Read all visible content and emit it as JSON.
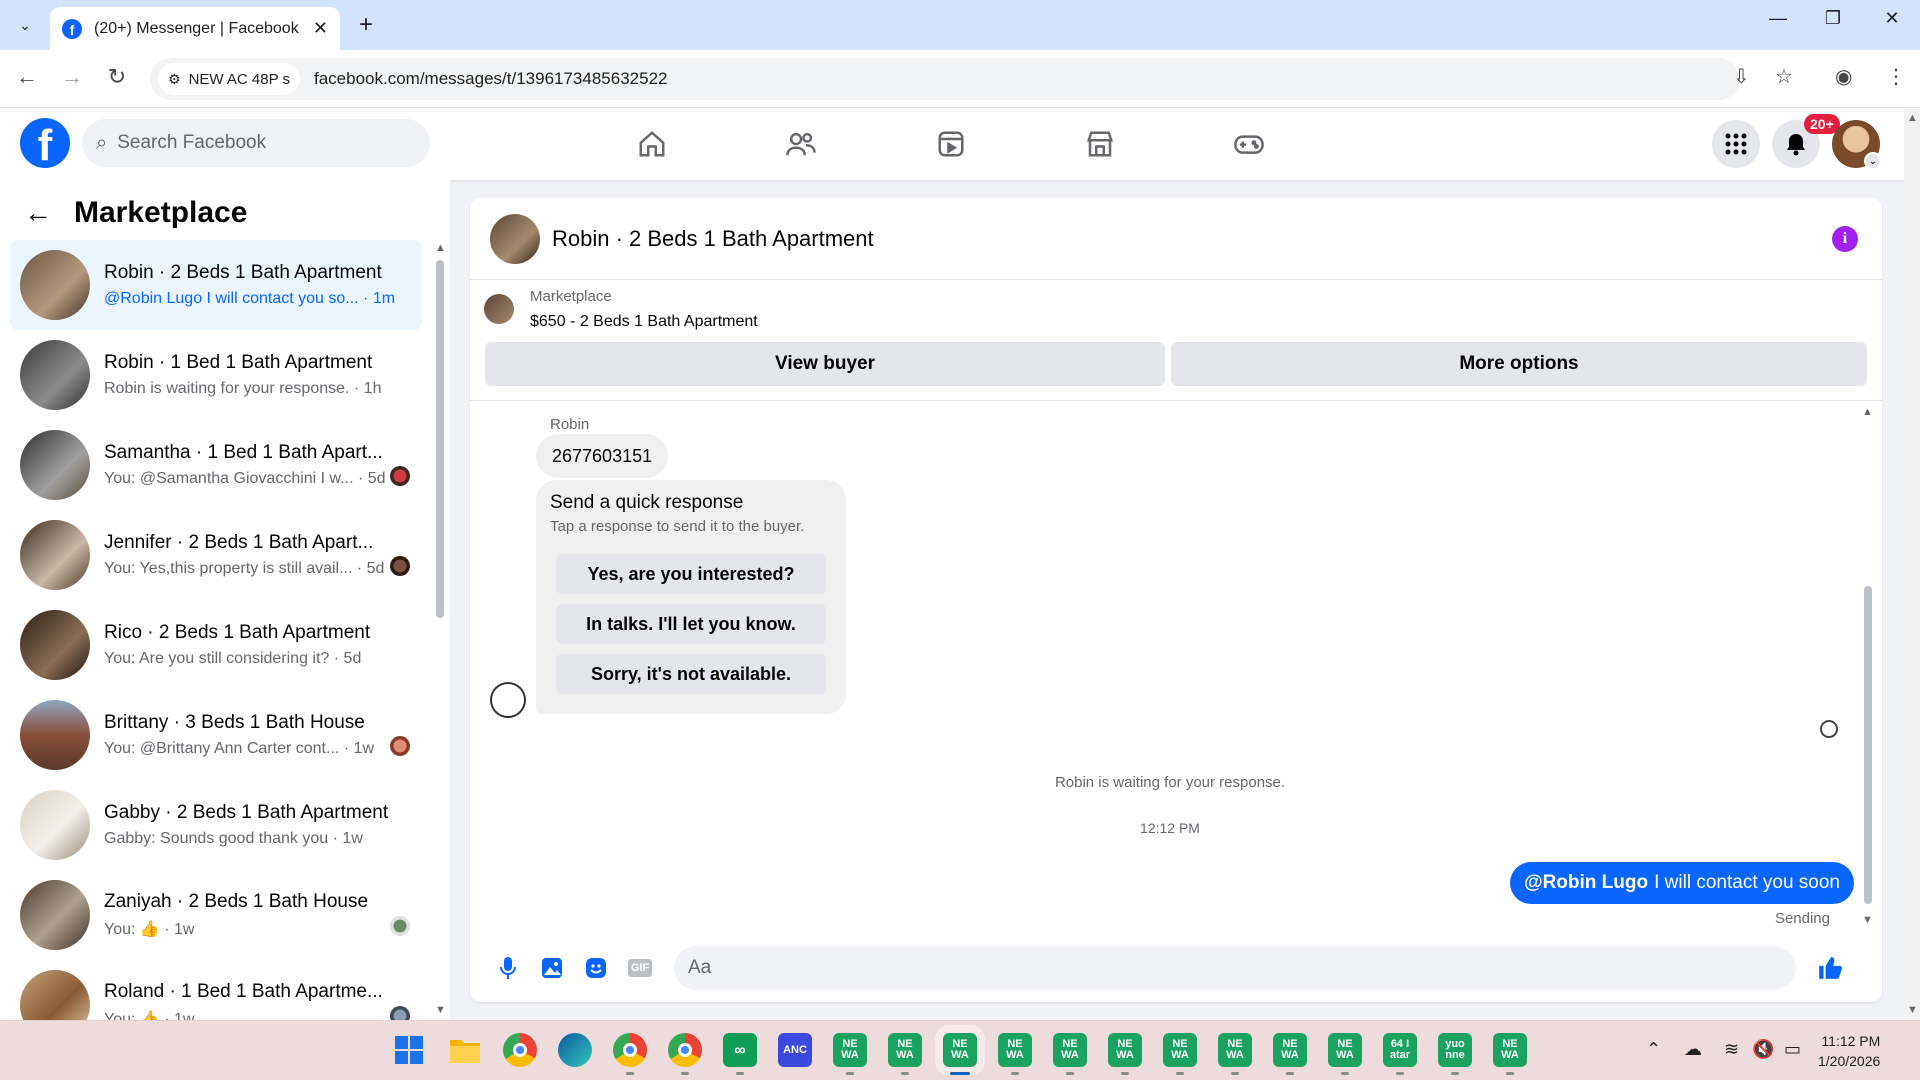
{
  "browser": {
    "tab_title": "(20+) Messenger | Facebook",
    "site_chip": "NEW AC 48P s",
    "url": "facebook.com/messages/t/1396173485632522"
  },
  "fb": {
    "search_placeholder": "Search Facebook",
    "notification_badge": "20+"
  },
  "sidebar": {
    "title": "Marketplace",
    "conversations": [
      {
        "name": "Robin · 2 Beds 1 Bath Apartment",
        "preview": "@Robin Lugo I will contact you so... · 1m",
        "active": true
      },
      {
        "name": "Robin · 1 Bed 1 Bath Apartment",
        "preview": "Robin is waiting for your response. · 1h"
      },
      {
        "name": "Samantha · 1 Bed 1 Bath Apart...",
        "preview": "You: @Samantha Giovacchini I w... · 5d"
      },
      {
        "name": "Jennifer · 2 Beds 1 Bath Apart...",
        "preview": "You: Yes,this property is still avail... · 5d"
      },
      {
        "name": "Rico · 2 Beds 1 Bath Apartment",
        "preview": "You: Are you still considering it? · 5d"
      },
      {
        "name": "Brittany · 3 Beds 1 Bath House",
        "preview": "You: @Brittany Ann Carter cont... · 1w"
      },
      {
        "name": "Gabby · 2 Beds 1 Bath Apartment",
        "preview": "Gabby: Sounds good thank you · 1w"
      },
      {
        "name": "Zaniyah · 2 Beds 1 Bath House",
        "preview": "You: 👍 · 1w"
      },
      {
        "name": "Roland · 1 Bed 1 Bath Apartme...",
        "preview": "You: 👍 · 1w"
      }
    ]
  },
  "chat": {
    "title": "Robin · 2 Beds 1 Bath Apartment",
    "marketplace_label": "Marketplace",
    "listing": "$650 - 2 Beds 1 Bath Apartment",
    "view_buyer": "View buyer",
    "more_options": "More options",
    "sender_name": "Robin",
    "incoming_message": "2677603151",
    "quick_response": {
      "title": "Send a quick response",
      "subtitle": "Tap a response to send it to the buyer.",
      "options": [
        "Yes, are you interested?",
        "In talks. I'll let you know.",
        "Sorry, it's not available."
      ]
    },
    "waiting_note": "Robin is waiting for your response.",
    "timestamp": "12:12 PM",
    "outgoing_mention": "@Robin Lugo",
    "outgoing_text": "I will contact you soon",
    "send_status": "Sending",
    "composer_placeholder": "Aa"
  },
  "taskbar": {
    "apps": [
      {
        "label": "NE WA"
      },
      {
        "label": "NE WA"
      },
      {
        "label": "NE WA"
      },
      {
        "label": "NE WA"
      },
      {
        "label": "NE WA"
      },
      {
        "label": "NE WA"
      },
      {
        "label": "NE WA"
      },
      {
        "label": "NE WA"
      },
      {
        "label": "NE WA"
      },
      {
        "label": "NE WA"
      },
      {
        "label": "64 I atar"
      },
      {
        "label": "yuo nne"
      },
      {
        "label": "NE WA"
      }
    ],
    "time": "11:12 PM",
    "date": "1/20/2026"
  },
  "colors": {
    "fb_blue": "#0866ff",
    "active_conv": "#ebf5ff",
    "badge_red": "#e41e3f",
    "info_purple": "#a020f0",
    "wa_green": "#1aa260"
  }
}
